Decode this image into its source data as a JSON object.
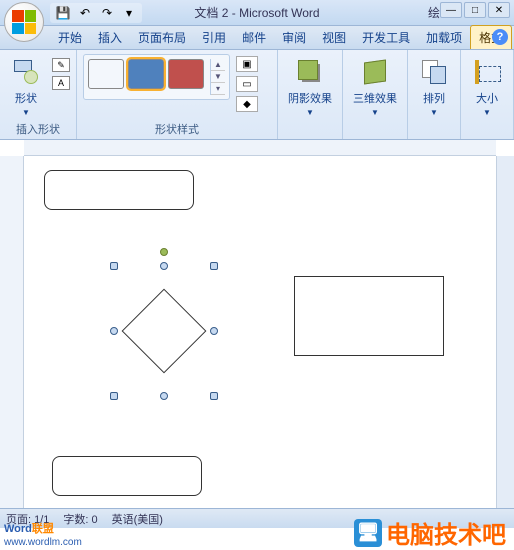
{
  "title": "文档 2 - Microsoft Word",
  "ext_label": "绘",
  "tabs": {
    "t0": "开始",
    "t1": "插入",
    "t2": "页面布局",
    "t3": "引用",
    "t4": "邮件",
    "t5": "审阅",
    "t6": "视图",
    "t7": "开发工具",
    "t8": "加载项",
    "t9": "格式"
  },
  "ribbon": {
    "insert_shape": {
      "label": "形状",
      "group": "插入形状"
    },
    "styles": {
      "group": "形状样式",
      "colors": {
        "c0": "#1a1a1a",
        "c1": "#4f81bd",
        "c2": "#c0504d"
      }
    },
    "shadow": "阴影效果",
    "threed": "三维效果",
    "arrange": "排列",
    "size": "大小"
  },
  "status": {
    "page": "页面: 1/1",
    "words": "字数: 0",
    "lang": "英语(美国)"
  },
  "watermark": {
    "brand_a": "Word",
    "brand_b": "联盟",
    "url": "www.wordlm.com",
    "site": "电脑技术吧"
  }
}
